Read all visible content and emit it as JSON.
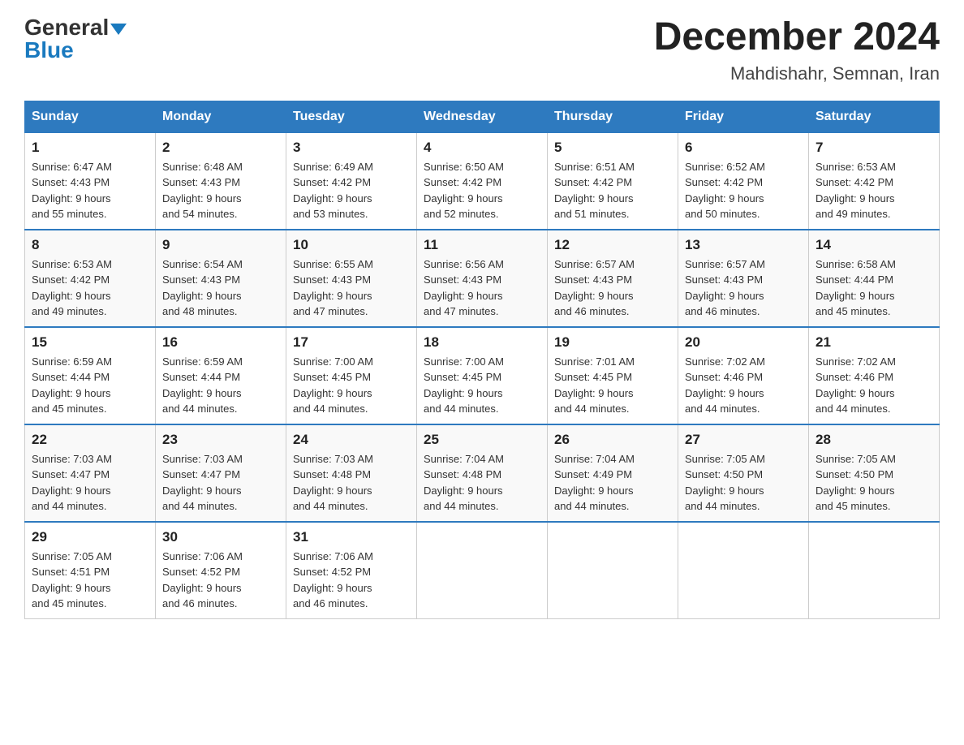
{
  "header": {
    "logo_general": "General",
    "logo_blue": "Blue",
    "month_title": "December 2024",
    "location": "Mahdishahr, Semnan, Iran"
  },
  "days_of_week": [
    "Sunday",
    "Monday",
    "Tuesday",
    "Wednesday",
    "Thursday",
    "Friday",
    "Saturday"
  ],
  "weeks": [
    [
      {
        "day": "1",
        "sunrise": "6:47 AM",
        "sunset": "4:43 PM",
        "daylight": "9 hours and 55 minutes."
      },
      {
        "day": "2",
        "sunrise": "6:48 AM",
        "sunset": "4:43 PM",
        "daylight": "9 hours and 54 minutes."
      },
      {
        "day": "3",
        "sunrise": "6:49 AM",
        "sunset": "4:42 PM",
        "daylight": "9 hours and 53 minutes."
      },
      {
        "day": "4",
        "sunrise": "6:50 AM",
        "sunset": "4:42 PM",
        "daylight": "9 hours and 52 minutes."
      },
      {
        "day": "5",
        "sunrise": "6:51 AM",
        "sunset": "4:42 PM",
        "daylight": "9 hours and 51 minutes."
      },
      {
        "day": "6",
        "sunrise": "6:52 AM",
        "sunset": "4:42 PM",
        "daylight": "9 hours and 50 minutes."
      },
      {
        "day": "7",
        "sunrise": "6:53 AM",
        "sunset": "4:42 PM",
        "daylight": "9 hours and 49 minutes."
      }
    ],
    [
      {
        "day": "8",
        "sunrise": "6:53 AM",
        "sunset": "4:42 PM",
        "daylight": "9 hours and 49 minutes."
      },
      {
        "day": "9",
        "sunrise": "6:54 AM",
        "sunset": "4:43 PM",
        "daylight": "9 hours and 48 minutes."
      },
      {
        "day": "10",
        "sunrise": "6:55 AM",
        "sunset": "4:43 PM",
        "daylight": "9 hours and 47 minutes."
      },
      {
        "day": "11",
        "sunrise": "6:56 AM",
        "sunset": "4:43 PM",
        "daylight": "9 hours and 47 minutes."
      },
      {
        "day": "12",
        "sunrise": "6:57 AM",
        "sunset": "4:43 PM",
        "daylight": "9 hours and 46 minutes."
      },
      {
        "day": "13",
        "sunrise": "6:57 AM",
        "sunset": "4:43 PM",
        "daylight": "9 hours and 46 minutes."
      },
      {
        "day": "14",
        "sunrise": "6:58 AM",
        "sunset": "4:44 PM",
        "daylight": "9 hours and 45 minutes."
      }
    ],
    [
      {
        "day": "15",
        "sunrise": "6:59 AM",
        "sunset": "4:44 PM",
        "daylight": "9 hours and 45 minutes."
      },
      {
        "day": "16",
        "sunrise": "6:59 AM",
        "sunset": "4:44 PM",
        "daylight": "9 hours and 44 minutes."
      },
      {
        "day": "17",
        "sunrise": "7:00 AM",
        "sunset": "4:45 PM",
        "daylight": "9 hours and 44 minutes."
      },
      {
        "day": "18",
        "sunrise": "7:00 AM",
        "sunset": "4:45 PM",
        "daylight": "9 hours and 44 minutes."
      },
      {
        "day": "19",
        "sunrise": "7:01 AM",
        "sunset": "4:45 PM",
        "daylight": "9 hours and 44 minutes."
      },
      {
        "day": "20",
        "sunrise": "7:02 AM",
        "sunset": "4:46 PM",
        "daylight": "9 hours and 44 minutes."
      },
      {
        "day": "21",
        "sunrise": "7:02 AM",
        "sunset": "4:46 PM",
        "daylight": "9 hours and 44 minutes."
      }
    ],
    [
      {
        "day": "22",
        "sunrise": "7:03 AM",
        "sunset": "4:47 PM",
        "daylight": "9 hours and 44 minutes."
      },
      {
        "day": "23",
        "sunrise": "7:03 AM",
        "sunset": "4:47 PM",
        "daylight": "9 hours and 44 minutes."
      },
      {
        "day": "24",
        "sunrise": "7:03 AM",
        "sunset": "4:48 PM",
        "daylight": "9 hours and 44 minutes."
      },
      {
        "day": "25",
        "sunrise": "7:04 AM",
        "sunset": "4:48 PM",
        "daylight": "9 hours and 44 minutes."
      },
      {
        "day": "26",
        "sunrise": "7:04 AM",
        "sunset": "4:49 PM",
        "daylight": "9 hours and 44 minutes."
      },
      {
        "day": "27",
        "sunrise": "7:05 AM",
        "sunset": "4:50 PM",
        "daylight": "9 hours and 44 minutes."
      },
      {
        "day": "28",
        "sunrise": "7:05 AM",
        "sunset": "4:50 PM",
        "daylight": "9 hours and 45 minutes."
      }
    ],
    [
      {
        "day": "29",
        "sunrise": "7:05 AM",
        "sunset": "4:51 PM",
        "daylight": "9 hours and 45 minutes."
      },
      {
        "day": "30",
        "sunrise": "7:06 AM",
        "sunset": "4:52 PM",
        "daylight": "9 hours and 46 minutes."
      },
      {
        "day": "31",
        "sunrise": "7:06 AM",
        "sunset": "4:52 PM",
        "daylight": "9 hours and 46 minutes."
      },
      null,
      null,
      null,
      null
    ]
  ],
  "labels": {
    "sunrise": "Sunrise:",
    "sunset": "Sunset:",
    "daylight": "Daylight:"
  }
}
